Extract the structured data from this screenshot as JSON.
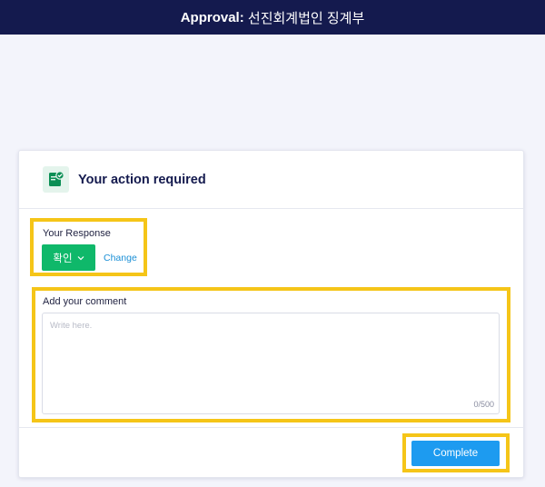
{
  "header": {
    "prefix": "Approval:",
    "company_name": "선진회계법인 징계부"
  },
  "card": {
    "title": "Your action required",
    "icon": "clipboard-check-icon"
  },
  "response": {
    "label": "Your Response",
    "selected_value": "확인",
    "change_label": "Change"
  },
  "comment": {
    "label": "Add your comment",
    "placeholder": "Write here.",
    "value": "",
    "counter": "0/500"
  },
  "footer": {
    "complete_label": "Complete"
  },
  "colors": {
    "header_bg": "#141a4e",
    "response_green": "#0fb86a",
    "complete_blue": "#1d9bf0",
    "highlight_yellow": "#f5c518",
    "link_blue": "#1a8fd6"
  }
}
